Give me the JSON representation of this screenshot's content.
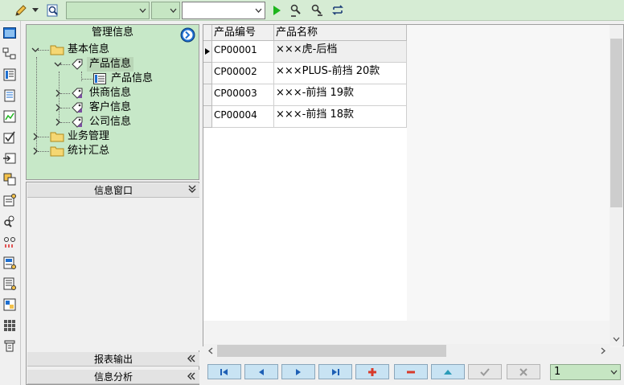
{
  "toolbar": {
    "combo1_value": "",
    "combo2_value": "",
    "combo3_value": "",
    "icons": [
      "pencil-icon",
      "search-icon",
      "run-icon",
      "find-user-icon",
      "find-next-icon",
      "refresh-icon"
    ]
  },
  "sidebar_icons": [
    "window-icon",
    "network-icon",
    "list-icon",
    "document-icon",
    "chart-icon",
    "checkbox-icon",
    "export-icon",
    "grid-icon",
    "settings-icon",
    "users-icon",
    "link-icon",
    "report-icon",
    "report-edit-icon",
    "table-icon",
    "apps-icon",
    "pin-icon"
  ],
  "tree": {
    "header": "管理信息",
    "nodes": [
      {
        "label": "基本信息",
        "icon": "folder-icon"
      },
      {
        "label": "产品信息",
        "icon": "tag-icon"
      },
      {
        "label": "产品信息",
        "icon": "table-icon"
      },
      {
        "label": "供商信息",
        "icon": "tag-icon"
      },
      {
        "label": "客户信息",
        "icon": "tag-icon"
      },
      {
        "label": "公司信息",
        "icon": "tag-icon"
      },
      {
        "label": "业务管理",
        "icon": "folder-icon"
      },
      {
        "label": "统计汇总",
        "icon": "folder-icon"
      }
    ]
  },
  "info_panel": {
    "title": "信息窗口",
    "report_output": "报表输出",
    "info_analysis": "信息分析"
  },
  "grid": {
    "columns": [
      "产品编号",
      "产品名称"
    ],
    "rows": [
      {
        "code": "CP00001",
        "name": "×××虎-后档"
      },
      {
        "code": "CP00002",
        "name": "×××PLUS-前挡 20款"
      },
      {
        "code": "CP00003",
        "name": "×××-前挡 19款"
      },
      {
        "code": "CP00004",
        "name": "×××-前挡 18款"
      }
    ]
  },
  "navigator": {
    "buttons": [
      "first-button",
      "prior-button",
      "next-button",
      "last-button",
      "insert-button",
      "delete-button",
      "edit-button",
      "post-button",
      "cancel-button"
    ],
    "page_value": "1"
  },
  "colors": {
    "toolbar_bg": "#d6ecd4",
    "tree_bg": "#c7e8c8",
    "nav_button": "#c8e3f3",
    "accent_blue": "#1e6fd0"
  }
}
